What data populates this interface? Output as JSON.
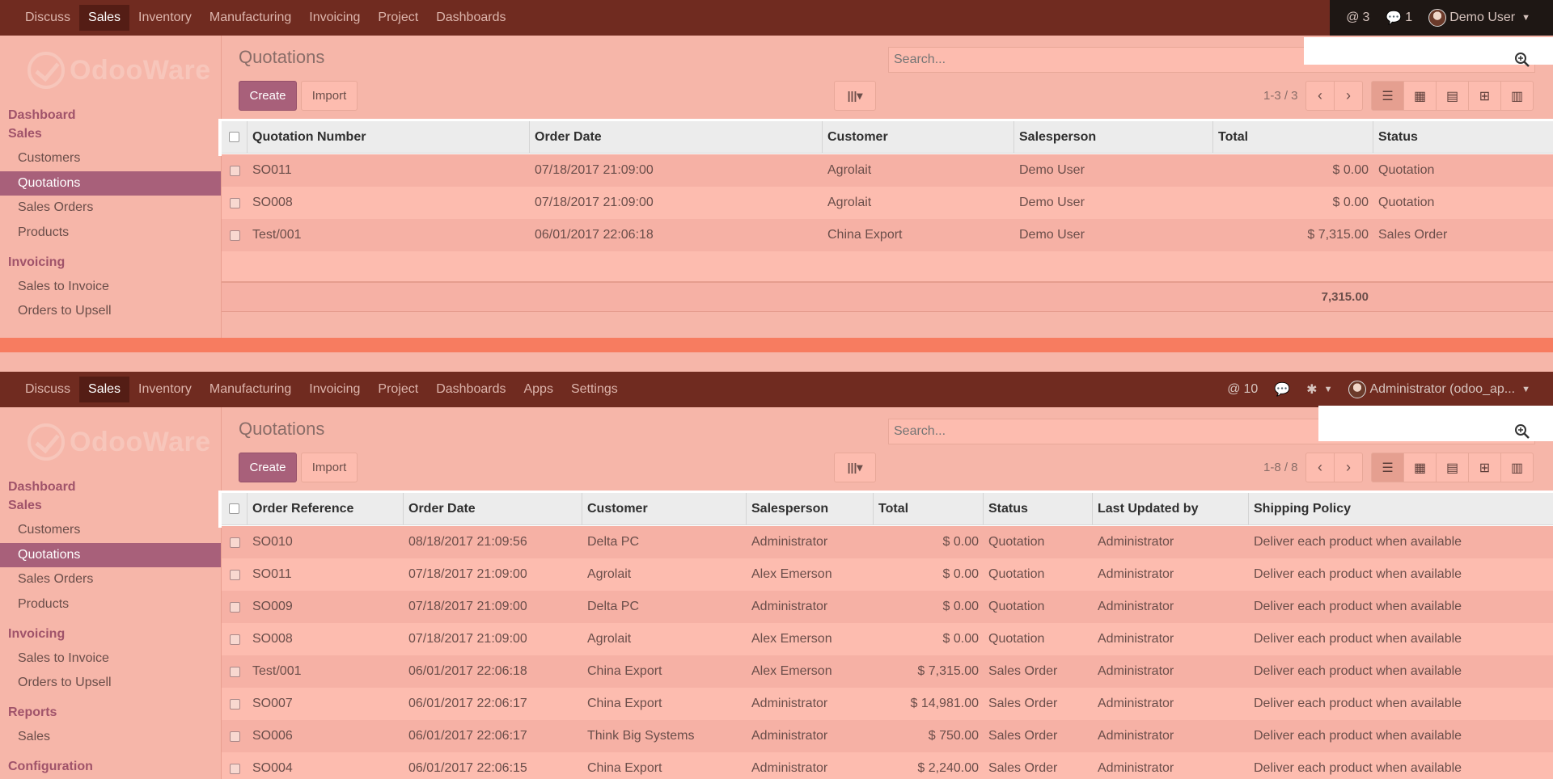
{
  "panel1": {
    "nav": {
      "items": [
        "Discuss",
        "Sales",
        "Inventory",
        "Manufacturing",
        "Invoicing",
        "Project",
        "Dashboards"
      ],
      "active": "Sales",
      "mentions": "3",
      "messages": "1",
      "user": "Demo User"
    },
    "sidebar": {
      "logo": "OdooWare",
      "dashboard": "Dashboard",
      "sales_head": "Sales",
      "sales_items": [
        "Customers",
        "Quotations",
        "Sales Orders",
        "Products"
      ],
      "invoicing_head": "Invoicing",
      "invoicing_items": [
        "Sales to Invoice",
        "Orders to Upsell"
      ]
    },
    "title": "Quotations",
    "search_placeholder": "Search...",
    "create_label": "Create",
    "import_label": "Import",
    "pager": "1-3 / 3",
    "columns": [
      "Quotation Number",
      "Order Date",
      "Customer",
      "Salesperson",
      "Total",
      "Status"
    ],
    "rows": [
      [
        "SO011",
        "07/18/2017 21:09:00",
        "Agrolait",
        "Demo User",
        "$ 0.00",
        "Quotation"
      ],
      [
        "SO008",
        "07/18/2017 21:09:00",
        "Agrolait",
        "Demo User",
        "$ 0.00",
        "Quotation"
      ],
      [
        "Test/001",
        "06/01/2017 22:06:18",
        "China Export",
        "Demo User",
        "$ 7,315.00",
        "Sales Order"
      ]
    ],
    "total": "7,315.00"
  },
  "panel2": {
    "nav": {
      "items": [
        "Discuss",
        "Sales",
        "Inventory",
        "Manufacturing",
        "Invoicing",
        "Project",
        "Dashboards",
        "Apps",
        "Settings"
      ],
      "active": "Sales",
      "mentions": "10",
      "user": "Administrator (odoo_ap..."
    },
    "sidebar": {
      "logo": "OdooWare",
      "dashboard": "Dashboard",
      "sales_head": "Sales",
      "sales_items": [
        "Customers",
        "Quotations",
        "Sales Orders",
        "Products"
      ],
      "invoicing_head": "Invoicing",
      "invoicing_items": [
        "Sales to Invoice",
        "Orders to Upsell"
      ],
      "reports_head": "Reports",
      "reports_items": [
        "Sales"
      ],
      "configuration_head": "Configuration"
    },
    "title": "Quotations",
    "search_placeholder": "Search...",
    "create_label": "Create",
    "import_label": "Import",
    "pager": "1-8 / 8",
    "columns": [
      "Order Reference",
      "Order Date",
      "Customer",
      "Salesperson",
      "Total",
      "Status",
      "Last Updated by",
      "Shipping Policy"
    ],
    "rows": [
      [
        "SO010",
        "08/18/2017 21:09:56",
        "Delta PC",
        "Administrator",
        "$ 0.00",
        "Quotation",
        "Administrator",
        "Deliver each product when available"
      ],
      [
        "SO011",
        "07/18/2017 21:09:00",
        "Agrolait",
        "Alex Emerson",
        "$ 0.00",
        "Quotation",
        "Administrator",
        "Deliver each product when available"
      ],
      [
        "SO009",
        "07/18/2017 21:09:00",
        "Delta PC",
        "Administrator",
        "$ 0.00",
        "Quotation",
        "Administrator",
        "Deliver each product when available"
      ],
      [
        "SO008",
        "07/18/2017 21:09:00",
        "Agrolait",
        "Alex Emerson",
        "$ 0.00",
        "Quotation",
        "Administrator",
        "Deliver each product when available"
      ],
      [
        "Test/001",
        "06/01/2017 22:06:18",
        "China Export",
        "Alex Emerson",
        "$ 7,315.00",
        "Sales Order",
        "Administrator",
        "Deliver each product when available"
      ],
      [
        "SO007",
        "06/01/2017 22:06:17",
        "China Export",
        "Administrator",
        "$ 14,981.00",
        "Sales Order",
        "Administrator",
        "Deliver each product when available"
      ],
      [
        "SO006",
        "06/01/2017 22:06:17",
        "Think Big Systems",
        "Administrator",
        "$ 750.00",
        "Sales Order",
        "Administrator",
        "Deliver each product when available"
      ],
      [
        "SO004",
        "06/01/2017 22:06:15",
        "China Export",
        "Administrator",
        "$ 2,240.00",
        "Sales Order",
        "Administrator",
        "Deliver each product when available"
      ]
    ]
  },
  "colors": {
    "nav_bg": "#702b20",
    "accent": "#a8607a",
    "panel_bg": "#f6b6a9",
    "divider": "#f77c60"
  }
}
